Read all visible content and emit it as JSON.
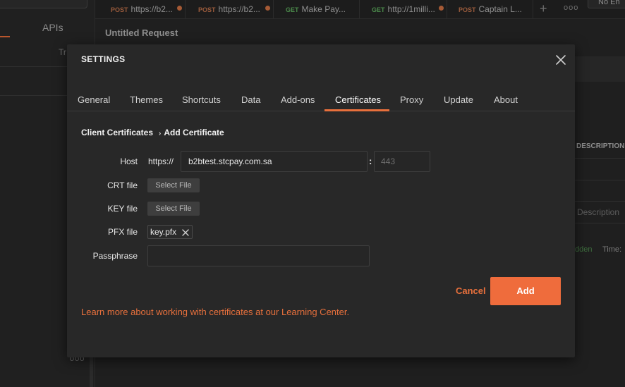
{
  "background": {
    "sidebar": {
      "tab_label": "APIs",
      "partial_label": "Tr"
    },
    "tabs": [
      {
        "method": "POST",
        "title": "https://b2...",
        "modified": true
      },
      {
        "method": "POST",
        "title": "https://b2...",
        "modified": true
      },
      {
        "method": "GET",
        "title": "Make Pay...",
        "modified": false
      },
      {
        "method": "GET",
        "title": "http://1milli...",
        "modified": true
      },
      {
        "method": "POST",
        "title": "Captain L...",
        "modified": false
      }
    ],
    "environment_label": "No En",
    "request_title": "Untitled Request",
    "description_header": "DESCRIPTION",
    "description_placeholder": "Description",
    "hidden_label": "dden",
    "time_label": "Time:"
  },
  "modal": {
    "title": "SETTINGS",
    "tabs": [
      "General",
      "Themes",
      "Shortcuts",
      "Data",
      "Add-ons",
      "Certificates",
      "Proxy",
      "Update",
      "About"
    ],
    "active_tab": "Certificates",
    "breadcrumb": {
      "parent": "Client Certificates",
      "current": "Add Certificate"
    },
    "form": {
      "host_label": "Host",
      "host_prefix": "https://",
      "host_value": "b2btest.stcpay.com.sa",
      "port_placeholder": "443",
      "crt_label": "CRT file",
      "crt_button": "Select File",
      "key_label": "KEY file",
      "key_button": "Select File",
      "pfx_label": "PFX file",
      "pfx_value": "key.pfx",
      "passphrase_label": "Passphrase",
      "passphrase_value": ""
    },
    "cancel_label": "Cancel",
    "add_label": "Add",
    "learn_more": "Learn more about working with certificates at our Learning Center."
  },
  "colors": {
    "accent": "#ef6c3c",
    "modal_bg": "#282828",
    "page_bg": "#1f1f1f"
  }
}
